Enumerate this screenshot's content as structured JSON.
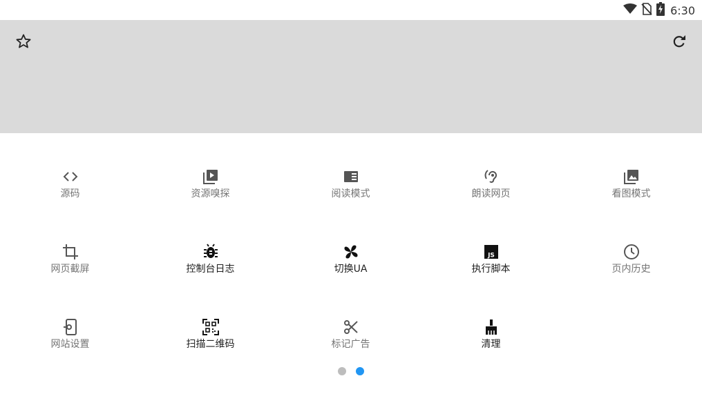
{
  "status_bar": {
    "time": "6:30",
    "icons": [
      "wifi-icon",
      "no-sim-icon",
      "battery-charging-icon"
    ]
  },
  "header": {
    "left_icon": "star-outline-icon",
    "right_icon": "refresh-icon"
  },
  "tools": [
    {
      "id": "source",
      "label": "源码",
      "icon": "code-icon",
      "style": "gray"
    },
    {
      "id": "resource-sniff",
      "label": "资源嗅探",
      "icon": "video-library-icon",
      "style": "gray"
    },
    {
      "id": "reading-mode",
      "label": "阅读模式",
      "icon": "reader-mode-icon",
      "style": "gray"
    },
    {
      "id": "read-aloud",
      "label": "朗读网页",
      "icon": "hearing-icon",
      "style": "gray"
    },
    {
      "id": "image-view",
      "label": "看图模式",
      "icon": "photo-library-icon",
      "style": "gray"
    },
    {
      "id": "screenshot",
      "label": "网页截屏",
      "icon": "crop-icon",
      "style": "gray"
    },
    {
      "id": "console-log",
      "label": "控制台日志",
      "icon": "bug-icon",
      "style": "dark"
    },
    {
      "id": "switch-ua",
      "label": "切换UA",
      "icon": "pinwheel-icon",
      "style": "dark"
    },
    {
      "id": "run-script",
      "label": "执行脚本",
      "icon": "javascript-icon",
      "style": "dark"
    },
    {
      "id": "page-history",
      "label": "页内历史",
      "icon": "clock-icon",
      "style": "gray"
    },
    {
      "id": "site-settings",
      "label": "网站设置",
      "icon": "phone-settings-icon",
      "style": "gray"
    },
    {
      "id": "scan-qr",
      "label": "扫描二维码",
      "icon": "qr-code-icon",
      "style": "dark"
    },
    {
      "id": "mark-ads",
      "label": "标记广告",
      "icon": "scissors-icon",
      "style": "gray"
    },
    {
      "id": "clean",
      "label": "清理",
      "icon": "broom-icon",
      "style": "dark"
    }
  ],
  "pager": {
    "pages": 2,
    "current": 2,
    "inactive_color": "#bdbdbd",
    "active_color": "#2196f3"
  }
}
